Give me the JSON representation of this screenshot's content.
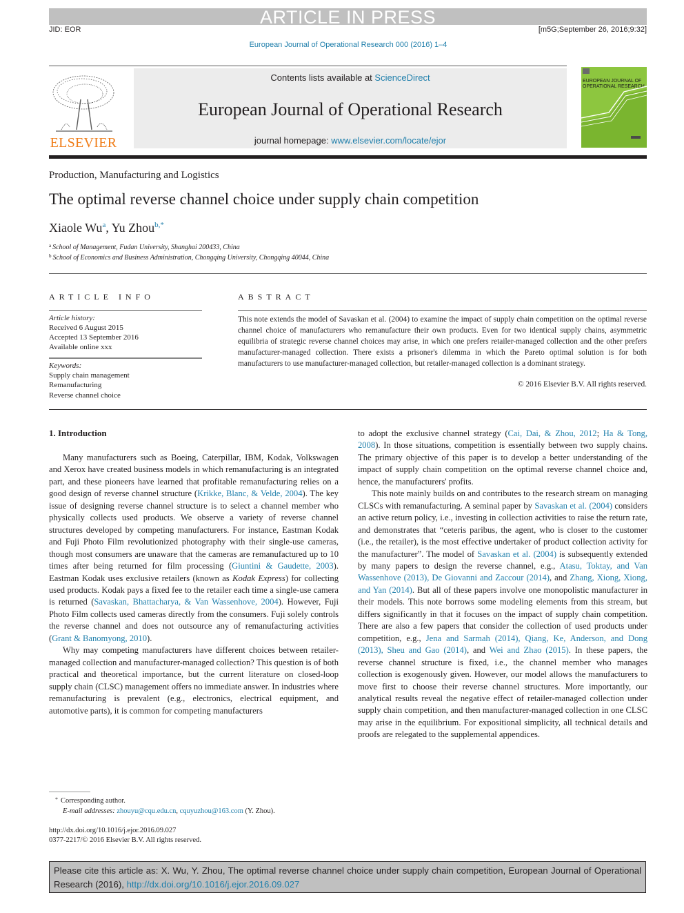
{
  "banner": {
    "article_in_press": "ARTICLE IN PRESS",
    "jid": "JID: EOR",
    "stamp": "[m5G;September 26, 2016;9:32]",
    "journal_reference": "European Journal of Operational Research 000 (2016) 1–4"
  },
  "masthead": {
    "publisher_logo": "ELSEVIER",
    "contents_prefix": "Contents lists available at ",
    "contents_link": "ScienceDirect",
    "journal_title": "European Journal of Operational Research",
    "homepage_prefix": "journal homepage: ",
    "homepage_link": "www.elsevier.com/locate/ejor",
    "cover_title_line1": "EUROPEAN JOURNAL OF",
    "cover_title_line2": "OPERATIONAL RESEARCH",
    "cover_color": "#8dc63f",
    "logo_color": "#f07d18"
  },
  "article": {
    "section": "Production, Manufacturing and Logistics",
    "title": "The optimal reverse channel choice under supply chain competition",
    "authors": [
      {
        "name": "Xiaole Wu",
        "sup": "a"
      },
      {
        "name": "Yu Zhou",
        "sup": "b,*"
      }
    ],
    "affiliations": [
      {
        "mark": "a",
        "text": "School of Management, Fudan University, Shanghai 200433, China"
      },
      {
        "mark": "b",
        "text": "School of Economics and Business Administration, Chongqing University, Chongqing 40044, China"
      }
    ]
  },
  "article_info": {
    "heading": "ARTICLE INFO",
    "history_label": "Article history:",
    "received": "Received 6 August 2015",
    "accepted": "Accepted 13 September 2016",
    "available": "Available online xxx",
    "keywords_label": "Keywords:",
    "keywords": [
      "Supply chain management",
      "Remanufacturing",
      "Reverse channel choice"
    ]
  },
  "abstract": {
    "heading": "ABSTRACT",
    "text": "This note extends the model of Savaskan et al. (2004) to examine the impact of supply chain competition on the optimal reverse channel choice of manufacturers who remanufacture their own products. Even for two identical supply chains, asymmetric equilibria of strategic reverse channel choices may arise, in which one prefers retailer-managed collection and the other prefers manufacturer-managed collection. There exists a prisoner's dilemma in which the Pareto optimal solution is for both manufacturers to use manufacturer-managed collection, but retailer-managed collection is a dominant strategy.",
    "copyright": "© 2016 Elsevier B.V. All rights reserved."
  },
  "body": {
    "intro_heading": "1. Introduction",
    "p1": [
      {
        "t": "Many manufacturers such as Boeing, Caterpillar, IBM, Kodak, Volkswagen and Xerox have created business models in which remanufacturing is an integrated part, and these pioneers have learned that profitable remanufacturing relies on a good design of reverse channel structure ("
      },
      {
        "link": "Krikke, Blanc, & Velde, 2004"
      },
      {
        "t": "). The key issue of designing reverse channel structure is to select a channel member who physically collects used products. We observe a variety of reverse channel structures developed by competing manufacturers. For instance, Eastman Kodak and Fuji Photo Film revolutionized photography with their single-use cameras, though most consumers are unaware that the cameras are remanufactured up to 10 times after being returned for film processing ("
      },
      {
        "link": "Giuntini & Gaudette, 2003"
      },
      {
        "t": "). Eastman Kodak uses exclusive retailers (known as "
      },
      {
        "em": "Kodak Express"
      },
      {
        "t": ") for collecting used products. Kodak pays a fixed fee to the retailer each time a single-use camera is returned ("
      },
      {
        "link": "Savaskan, Bhattacharya, & Van Wassenhove, 2004"
      },
      {
        "t": "). However, Fuji Photo Film collects used cameras directly from the consumers. Fuji solely controls the reverse channel and does not outsource any of remanufacturing activities ("
      },
      {
        "link": "Grant & Banomyong, 2010"
      },
      {
        "t": ")."
      }
    ],
    "p2": [
      {
        "t": "Why may competing manufacturers have different choices between retailer-managed collection and manufacturer-managed collection? This question is of both practical and theoretical importance, but the current literature on closed-loop supply chain (CLSC) management offers no immediate answer. In industries where remanufacturing is prevalent (e.g., electronics, electrical equipment, and automotive parts), it is common for competing manufacturers"
      }
    ],
    "p3": [
      {
        "t": "to adopt the exclusive channel strategy ("
      },
      {
        "link": "Cai, Dai, & Zhou, 2012"
      },
      {
        "t": "; "
      },
      {
        "link": "Ha & Tong, 2008"
      },
      {
        "t": "). In those situations, competition is essentially between two supply chains. The primary objective of this paper is to develop a better understanding of the impact of supply chain competition on the optimal reverse channel choice and, hence, the manufacturers' profits."
      }
    ],
    "p4": [
      {
        "t": "This note mainly builds on and contributes to the research stream on managing CLSCs with remanufacturing. A seminal paper by "
      },
      {
        "link": "Savaskan et al. (2004)"
      },
      {
        "t": " considers an active return policy, i.e., investing in collection activities to raise the return rate, and demonstrates that “ceteris paribus, the agent, who is closer to the customer (i.e., the retailer), is the most effective undertaker of product collection activity for the manufacturer”. The model of "
      },
      {
        "link": "Savaskan et al. (2004)"
      },
      {
        "t": " is subsequently extended by many papers to design the reverse channel, e.g., "
      },
      {
        "link": "Atasu, Toktay, and Van Wassenhove (2013), De Giovanni and Zaccour (2014)"
      },
      {
        "t": ", and "
      },
      {
        "link": "Zhang, Xiong, Xiong, and Yan (2014)"
      },
      {
        "t": ". But all of these papers involve one monopolistic manufacturer in their models. This note borrows some modeling elements from this stream, but differs significantly in that it focuses on the impact of supply chain competition. There are also a few papers that consider the collection of used products under competition, e.g., "
      },
      {
        "link": "Jena and Sarmah (2014), Qiang, Ke, Anderson, and Dong (2013), Sheu and Gao (2014)"
      },
      {
        "t": ", and "
      },
      {
        "link": "Wei and Zhao (2015)"
      },
      {
        "t": ". In these papers, the reverse channel structure is fixed, i.e., the channel member who manages collection is exogenously given. However, our model allows the manufacturers to move first to choose their reverse channel structures. More importantly, our analytical results reveal the negative effect of retailer-managed collection under supply chain competition, and then manufacturer-managed collection in one CLSC may arise in the equilibrium. For expositional simplicity, all technical details and proofs are relegated to the supplemental appendices."
      }
    ]
  },
  "footnotes": {
    "mark": "*",
    "corresponding": "Corresponding author.",
    "email_label": "E-mail addresses: ",
    "email1": "zhouyu@cqu.edu.cn",
    "email2": "cquyuzhou@163.com",
    "email_suffix": " (Y. Zhou).",
    "doi": "http://dx.doi.org/10.1016/j.ejor.2016.09.027",
    "issn": "0377-2217/© 2016 Elsevier B.V. All rights reserved."
  },
  "citation_box": {
    "text": "Please cite this article as: X. Wu, Y. Zhou, The optimal reverse channel choice under supply chain competition, European Journal of Operational Research (2016), ",
    "link": "http://dx.doi.org/10.1016/j.ejor.2016.09.027"
  }
}
